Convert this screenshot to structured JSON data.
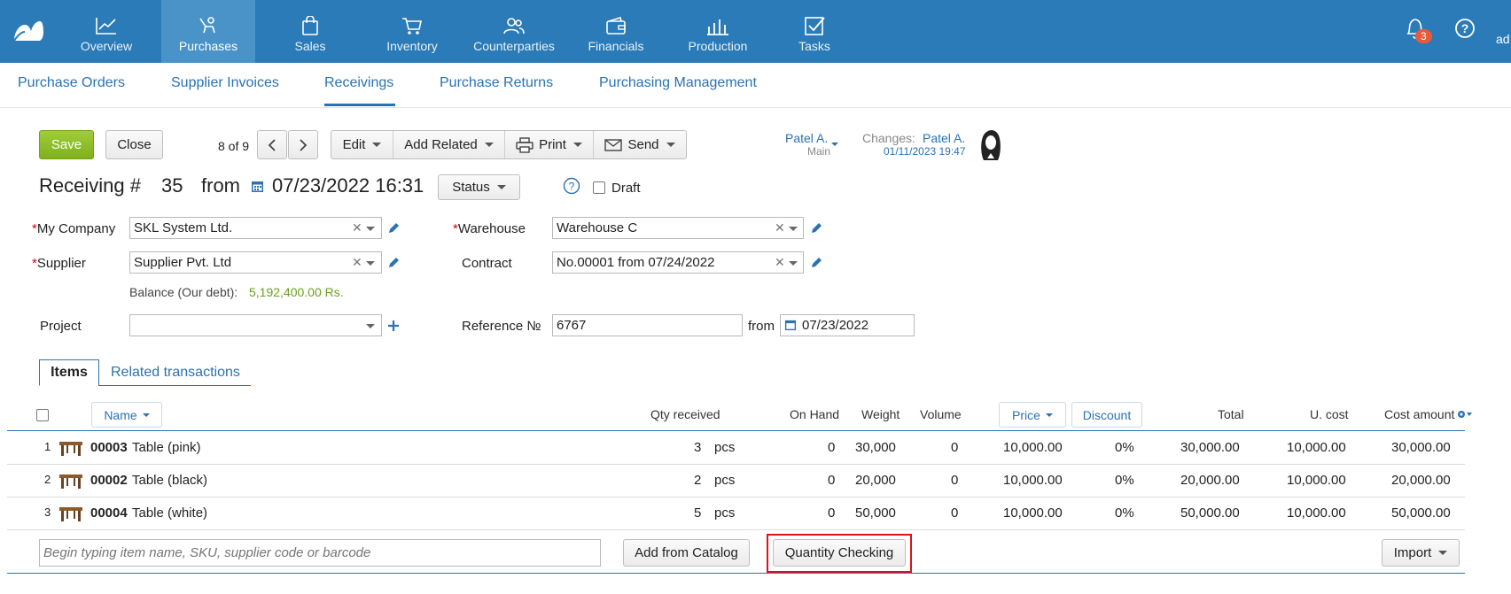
{
  "topnav": {
    "items": [
      {
        "label": "Overview",
        "icon": "chart-line-icon"
      },
      {
        "label": "Purchases",
        "icon": "purchases-hand-icon",
        "active": true
      },
      {
        "label": "Sales",
        "icon": "shopping-bag-icon"
      },
      {
        "label": "Inventory",
        "icon": "cart-icon"
      },
      {
        "label": "Counterparties",
        "icon": "people-icon"
      },
      {
        "label": "Financials",
        "icon": "wallet-icon"
      },
      {
        "label": "Production",
        "icon": "factory-icon"
      },
      {
        "label": "Tasks",
        "icon": "checkbox-icon"
      }
    ],
    "notifications_count": "3",
    "user_fragment": "ad",
    "brand_color": "#2a7bb8"
  },
  "subnav": {
    "items": [
      "Purchase Orders",
      "Supplier Invoices",
      "Receivings",
      "Purchase Returns",
      "Purchasing Management"
    ],
    "active": "Receivings"
  },
  "toolbar": {
    "save_label": "Save",
    "close_label": "Close",
    "pager": "8 of 9",
    "edit_label": "Edit",
    "add_related_label": "Add Related",
    "print_label": "Print",
    "send_label": "Send"
  },
  "owner": {
    "name": "Patel A.",
    "branch": "Main",
    "changes_label": "Changes:",
    "changes_user": "Patel A.",
    "changes_time": "01/11/2023 19:47"
  },
  "doc": {
    "title_prefix": "Receiving #",
    "number": "35",
    "from_label": "from",
    "datetime": "07/23/2022 16:31",
    "status_label": "Status",
    "draft_label": "Draft"
  },
  "form": {
    "my_company_label": "My Company",
    "my_company": "SKL System Ltd.",
    "warehouse_label": "Warehouse",
    "warehouse": "Warehouse C",
    "supplier_label": "Supplier",
    "supplier": "Supplier Pvt. Ltd",
    "contract_label": "Contract",
    "contract": "No.00001 from 07/24/2022",
    "balance_label": "Balance (Our debt):",
    "balance_value": "5,192,400.00 Rs.",
    "project_label": "Project",
    "project": "",
    "reference_label": "Reference №",
    "reference": "6767",
    "ref_from_label": "from",
    "ref_date": "07/23/2022"
  },
  "tabs": {
    "items": "Items",
    "related": "Related transactions"
  },
  "table": {
    "headers": {
      "name": "Name",
      "qty": "Qty received",
      "onhand": "On Hand",
      "weight": "Weight",
      "volume": "Volume",
      "price": "Price",
      "discount": "Discount",
      "total": "Total",
      "ucost": "U. cost",
      "costamount": "Cost amount"
    },
    "rows": [
      {
        "n": "1",
        "sku": "00003",
        "name": "Table (pink)",
        "qty": "3",
        "unit": "pcs",
        "onhand": "0",
        "weight": "30,000",
        "volume": "0",
        "price": "10,000.00",
        "discount": "0%",
        "total": "30,000.00",
        "ucost": "10,000.00",
        "cost": "30,000.00"
      },
      {
        "n": "2",
        "sku": "00002",
        "name": "Table (black)",
        "qty": "2",
        "unit": "pcs",
        "onhand": "0",
        "weight": "20,000",
        "volume": "0",
        "price": "10,000.00",
        "discount": "0%",
        "total": "20,000.00",
        "ucost": "10,000.00",
        "cost": "20,000.00"
      },
      {
        "n": "3",
        "sku": "00004",
        "name": "Table (white)",
        "qty": "5",
        "unit": "pcs",
        "onhand": "0",
        "weight": "50,000",
        "volume": "0",
        "price": "10,000.00",
        "discount": "0%",
        "total": "50,000.00",
        "ucost": "10,000.00",
        "cost": "50,000.00"
      }
    ]
  },
  "footer": {
    "search_placeholder": "Begin typing item name, SKU, supplier code or barcode",
    "add_catalog_label": "Add from Catalog",
    "qty_check_label": "Quantity Checking",
    "import_label": "Import"
  }
}
